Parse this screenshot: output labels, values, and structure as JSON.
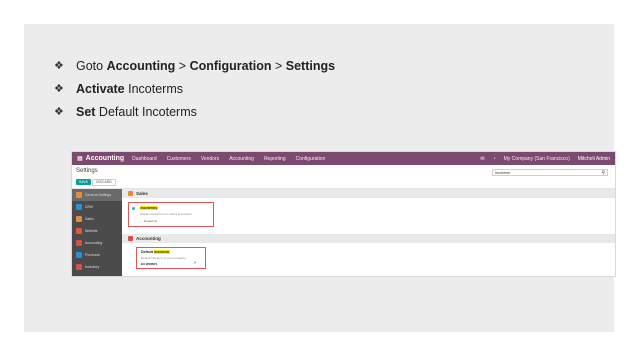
{
  "instructions": [
    {
      "bullet": "❖",
      "parts": [
        {
          "text": "Goto ",
          "bold": false
        },
        {
          "text": "Accounting",
          "bold": true
        },
        {
          "text": " > ",
          "bold": false
        },
        {
          "text": "Configuration",
          "bold": true
        },
        {
          "text": " > ",
          "bold": false
        },
        {
          "text": "Settings",
          "bold": true
        }
      ]
    },
    {
      "bullet": "❖",
      "parts": [
        {
          "text": "Activate",
          "bold": true
        },
        {
          "text": " Incoterms",
          "bold": false
        }
      ]
    },
    {
      "bullet": "❖",
      "parts": [
        {
          "text": "Set",
          "bold": true
        },
        {
          "text": " Default Incoterms",
          "bold": false
        }
      ]
    }
  ],
  "screenshot": {
    "navbar": {
      "apps_icon": "grid-icon",
      "app_name": "Accounting",
      "menus": [
        "Dashboard",
        "Customers",
        "Vendors",
        "Accounting",
        "Reporting",
        "Configuration"
      ],
      "company": "My Company (San Francisco)",
      "user": "Mitchell Admin",
      "color": "#7c4a6e"
    },
    "control_panel": {
      "title": "Settings",
      "save_label": "SAVE",
      "discard_label": "DISCARD",
      "search_value": "incoterm"
    },
    "sidebar": [
      {
        "label": "General Settings",
        "color": "#e88a3c",
        "active": true
      },
      {
        "label": "CRM",
        "color": "#2a8fd6",
        "active": false
      },
      {
        "label": "Sales",
        "color": "#e88a3c",
        "active": false
      },
      {
        "label": "Website",
        "color": "#e8543c",
        "active": false
      },
      {
        "label": "Accounting",
        "color": "#d54f4f",
        "active": false
      },
      {
        "label": "Purchase",
        "color": "#2a8fd6",
        "active": false
      },
      {
        "label": "Inventory",
        "color": "#d54f4f",
        "active": false
      }
    ],
    "sales_section": {
      "title": "Sales",
      "setting_title": "Incoterms",
      "setting_desc": "Display incoterms on orders & invoices",
      "link_label": "→ Incoterms"
    },
    "accounting_section": {
      "title": "Accounting",
      "setting_title_prefix": "Default ",
      "setting_title_highlight": "Incoterm",
      "setting_desc": "Default incoterm of your company",
      "value": "EX WORKS"
    },
    "highlight_color": "#e25555"
  }
}
